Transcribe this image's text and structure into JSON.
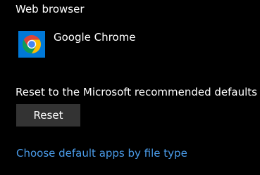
{
  "web_browser": {
    "title": "Web browser",
    "app": {
      "name": "Google Chrome",
      "icon": "chrome-icon",
      "tile_color": "#0078d7"
    }
  },
  "reset": {
    "label": "Reset to the Microsoft recommended defaults",
    "button_label": "Reset",
    "button_color": "#333333"
  },
  "links": {
    "file_type": "Choose default apps by file type",
    "link_color": "#4a9be8"
  }
}
